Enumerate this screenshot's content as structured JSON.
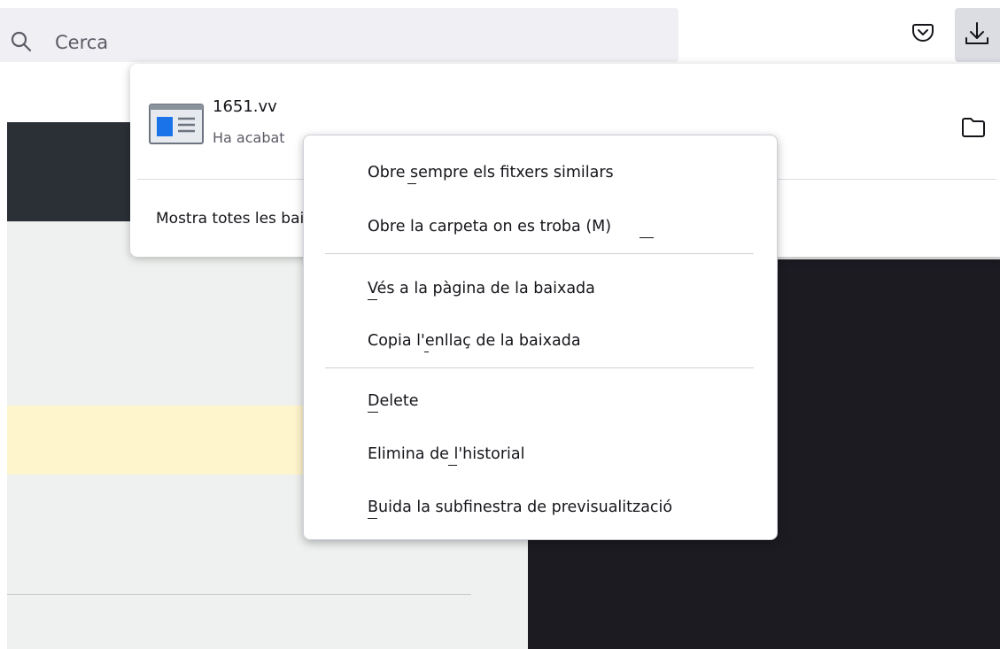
{
  "toolbar": {
    "search_placeholder": "Cerca",
    "icons": {
      "search": "magnifier-icon",
      "pocket": "pocket-icon",
      "downloads": "download-arrow-icon"
    }
  },
  "downloads_panel": {
    "file_name": "1651.vv",
    "file_status": "Ha acabat",
    "show_all_label": "Mostra totes les baixades",
    "icons": {
      "file": "web-file-icon",
      "open_folder": "folder-icon"
    }
  },
  "context_menu": {
    "items": [
      {
        "label": "Obre sempre els fitxers similars"
      },
      {
        "label": "Obre la carpeta on es troba (M)"
      },
      {
        "label": "Vés a la pàgina de la baixada"
      },
      {
        "label": "Copia l'enllaç de la baixada"
      },
      {
        "label": "Delete"
      },
      {
        "label": "Elimina de l'historial"
      },
      {
        "label": "Buida la subfinestra de previsualització"
      }
    ]
  }
}
